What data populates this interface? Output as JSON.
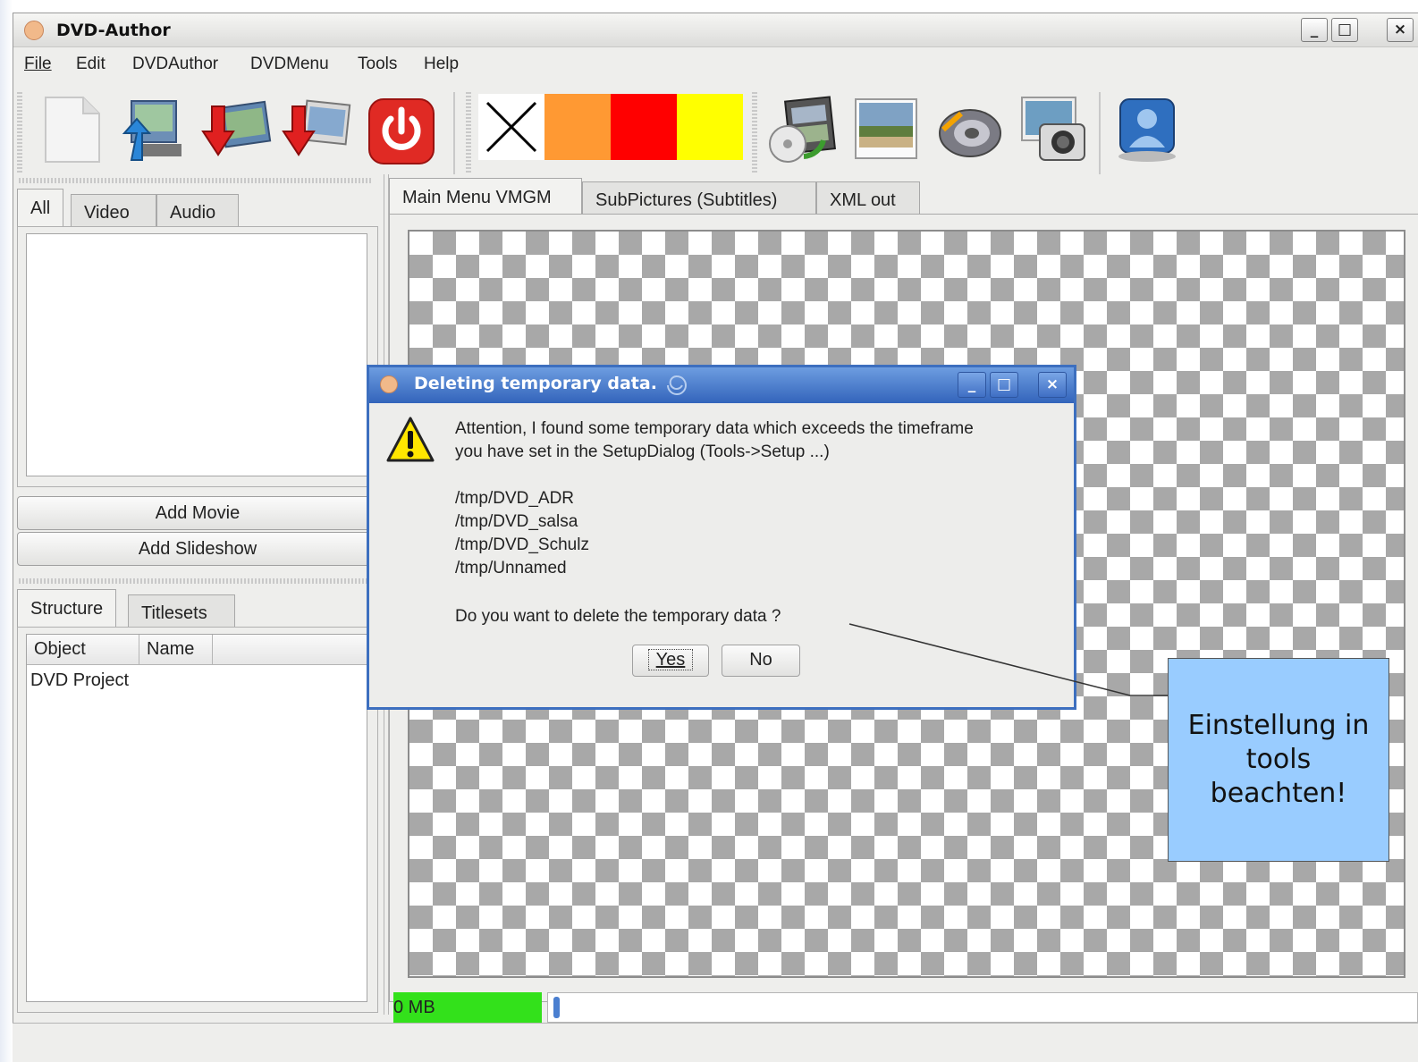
{
  "window": {
    "title": "DVD-Author"
  },
  "window_controls": {
    "minimize": "_",
    "maximize": "□",
    "close": "×"
  },
  "menu": [
    "File",
    "Edit",
    "DVDAuthor",
    "DVDMenu",
    "Tools",
    "Help"
  ],
  "toolbar": {
    "icons": [
      "new-file-icon",
      "import-icon",
      "add-movie-icon",
      "add-slideshow-icon",
      "power-icon",
      "close-x-icon",
      "color-orange",
      "color-red",
      "color-yellow",
      "film-dvd-icon",
      "photo-icon",
      "speaker-icon",
      "camera-icon",
      "user-icon"
    ],
    "colors": {
      "orange": "#ff9933",
      "red": "#ff0000",
      "yellow": "#ffff00"
    }
  },
  "source_tabs": [
    "All",
    "Video",
    "Audio"
  ],
  "buttons": {
    "add_movie": "Add Movie",
    "add_slideshow": "Add Slideshow"
  },
  "structure_tabs": [
    "Structure",
    "Titlesets"
  ],
  "structure_table": {
    "columns": [
      "Object",
      "Name"
    ],
    "rows": [
      "DVD Project"
    ]
  },
  "main_tabs": [
    "Main Menu VMGM",
    "SubPictures (Subtitles)",
    "XML out"
  ],
  "status": {
    "size_label": "0 MB",
    "accent": "#33e11b"
  },
  "dialog": {
    "title": "Deleting temporary data.",
    "message_line1": "Attention, I found some temporary data which exceeds the timeframe",
    "message_line2": "you have set in the SetupDialog (Tools->Setup ...)",
    "paths": [
      "/tmp/DVD_ADR",
      "/tmp/DVD_salsa",
      "/tmp/DVD_Schulz",
      "/tmp/Unnamed"
    ],
    "question": "Do you want to delete the temporary data ?",
    "yes_label": "Yes",
    "no_label": "No",
    "title_color": "#3d6fbf"
  },
  "annotation": {
    "line1": "Einstellung in",
    "line2": "tools",
    "line3": "beachten!",
    "color": "#99ccff"
  }
}
